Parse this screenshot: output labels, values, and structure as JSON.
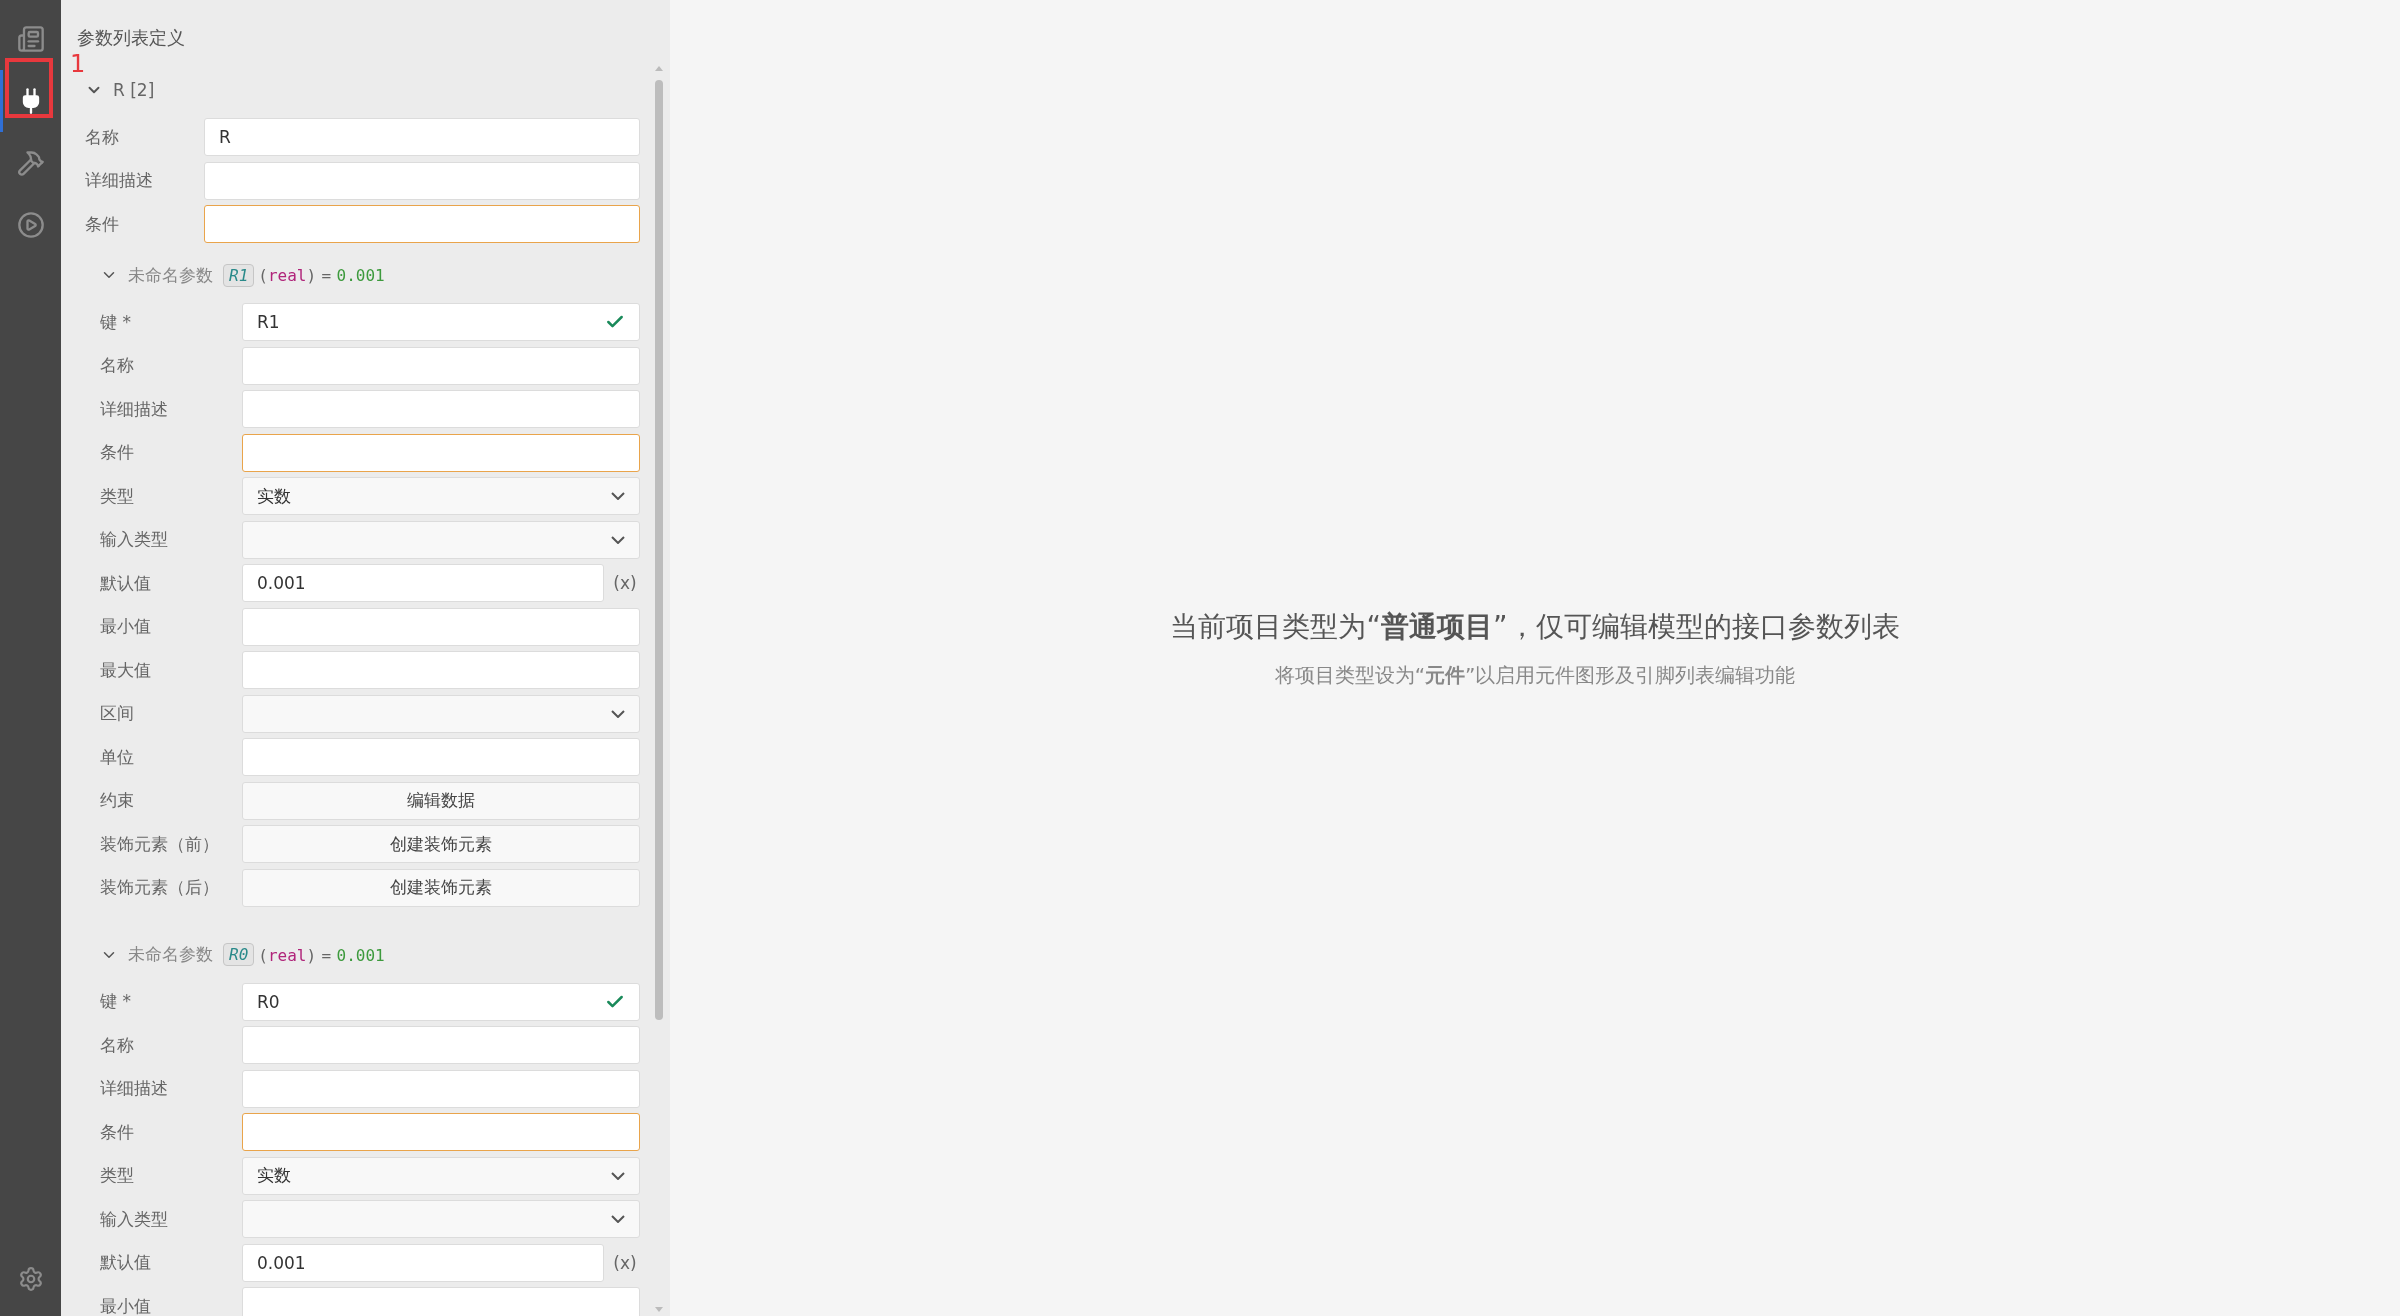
{
  "sidebar": {
    "items": [
      {
        "kind": "layout",
        "selected": false
      },
      {
        "kind": "plug",
        "selected": true
      },
      {
        "kind": "tools",
        "selected": false
      },
      {
        "kind": "run",
        "selected": false
      }
    ],
    "footer": {
      "kind": "settings"
    }
  },
  "annotation": {
    "label": "1"
  },
  "panel": {
    "title": "参数列表定义",
    "group": {
      "label": "R [2]",
      "expanded": true,
      "fields": [
        {
          "kind": "text",
          "label": "名称",
          "value": "R"
        },
        {
          "kind": "text",
          "label": "详细描述"
        },
        {
          "kind": "text",
          "label": "条件",
          "warning": true
        }
      ]
    },
    "params": [
      {
        "title": "未命名参数",
        "key_tag": "R1",
        "type_open": "(",
        "type_tag": "real",
        "type_close": ")",
        "equals": "=",
        "default_value": "0.001",
        "expanded": true,
        "fields": [
          {
            "kind": "key",
            "label": "键 *",
            "value": "R1",
            "valid": true
          },
          {
            "kind": "text",
            "label": "名称"
          },
          {
            "kind": "text",
            "label": "详细描述"
          },
          {
            "kind": "text",
            "label": "条件",
            "warning": true
          },
          {
            "kind": "select",
            "label": "类型",
            "value": "实数"
          },
          {
            "kind": "select",
            "label": "输入类型"
          },
          {
            "kind": "expr",
            "label": "默认值",
            "value": "0.001",
            "suffix": "(x)"
          },
          {
            "kind": "text",
            "label": "最小值"
          },
          {
            "kind": "text",
            "label": "最大值"
          },
          {
            "kind": "select",
            "label": "区间"
          },
          {
            "kind": "text",
            "label": "单位"
          },
          {
            "kind": "button",
            "label": "约束",
            "value": "编辑数据"
          },
          {
            "kind": "button",
            "label": "装饰元素（前）",
            "value": "创建装饰元素"
          },
          {
            "kind": "button",
            "label": "装饰元素（后）",
            "value": "创建装饰元素"
          }
        ]
      },
      {
        "title": "未命名参数",
        "key_tag": "R0",
        "type_open": "(",
        "type_tag": "real",
        "type_close": ")",
        "equals": "=",
        "default_value": "0.001",
        "expanded": true,
        "fields": [
          {
            "kind": "key",
            "label": "键 *",
            "value": "R0",
            "valid": true
          },
          {
            "kind": "text",
            "label": "名称"
          },
          {
            "kind": "text",
            "label": "详细描述"
          },
          {
            "kind": "text",
            "label": "条件",
            "warning": true
          },
          {
            "kind": "select",
            "label": "类型",
            "value": "实数"
          },
          {
            "kind": "select",
            "label": "输入类型"
          },
          {
            "kind": "expr",
            "label": "默认值",
            "value": "0.001",
            "suffix": "(x)"
          },
          {
            "kind": "text",
            "label": "最小值"
          }
        ]
      }
    ]
  },
  "message": {
    "headline": "当前项目类型为“**普通项目**”，仅可编辑模型的接口参数列表",
    "hint": "将项目类型设为“**元件**”以启用元件图形及引脚列表编辑功能"
  }
}
